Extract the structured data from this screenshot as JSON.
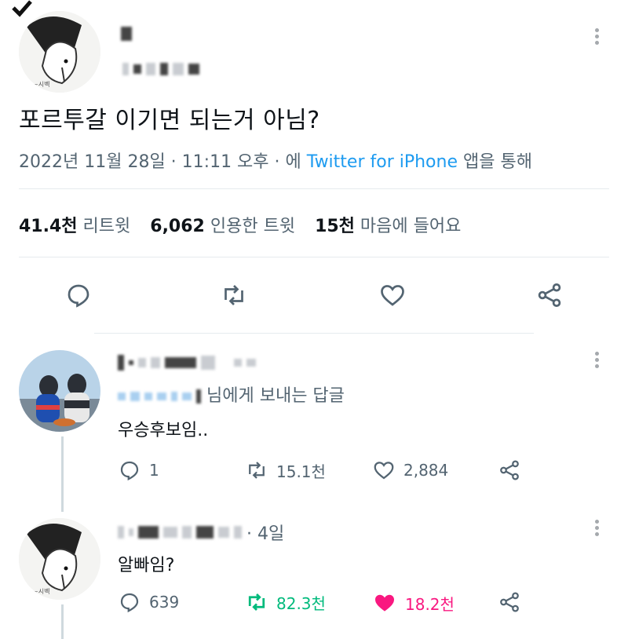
{
  "tweet": {
    "text": "포르투갈 이기면 되는거 아님?",
    "date": "2022년 11월 28일 · 11:11 오후 · 에",
    "source": "Twitter for iPhone",
    "via": "앱을 통해",
    "stats": {
      "retweets": "41.4천",
      "retweets_label": "리트윗",
      "quotes": "6,062",
      "quotes_label": "인용한 트윗",
      "likes": "15천",
      "likes_label": "마음에 들어요"
    }
  },
  "reply1": {
    "replying_suffix": "님에게 보내는 답글",
    "text": "우승후보임..",
    "replies": "1",
    "retweets": "15.1천",
    "likes": "2,884"
  },
  "reply2": {
    "time": "· 4일",
    "text": "알빠임?",
    "replies": "639",
    "retweets": "82.3천",
    "likes": "18.2천"
  },
  "colors": {
    "retweet_active": "#00ba7c",
    "like_active": "#f91880",
    "link": "#1d9bf0"
  }
}
